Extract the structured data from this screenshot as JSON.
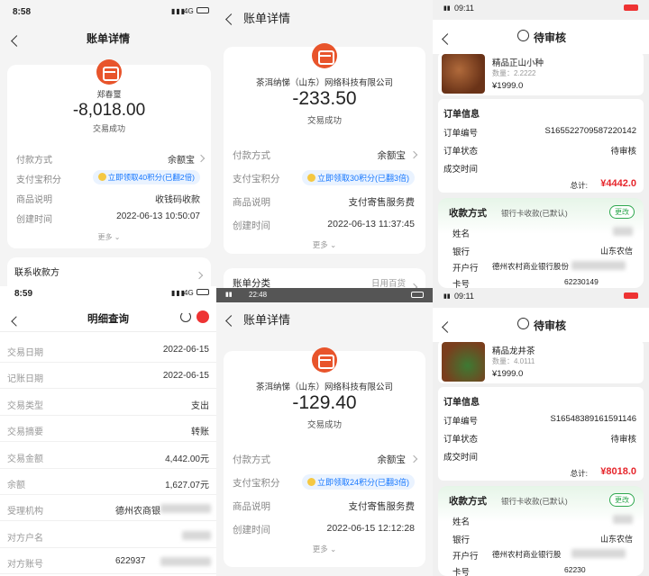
{
  "p1": {
    "status": {
      "time": "8:58",
      "net": "4G"
    },
    "title": "账单详情",
    "payee": "郑春璽",
    "amount": "-8,018.00",
    "state": "交易成功",
    "rows": [
      {
        "k": "付款方式",
        "v": "余额宝"
      },
      {
        "k": "支付宝积分",
        "v": "立即领取40积分(已翻2倍)"
      },
      {
        "k": "商品说明",
        "v": "收钱码收款"
      },
      {
        "k": "创建时间",
        "v": "2022-06-13 10:50:07"
      }
    ],
    "more": "更多",
    "contact": "联系收款方"
  },
  "p2": {
    "title": "账单详情",
    "payee": "茶洱纳悌（山东）网络科技有限公司",
    "amount": "-233.50",
    "state": "交易成功",
    "rows": [
      {
        "k": "付款方式",
        "v": "余额宝"
      },
      {
        "k": "支付宝积分",
        "v": "立即领取30积分(已翻3倍)"
      },
      {
        "k": "商品说明",
        "v": "支付寄售服务费"
      },
      {
        "k": "创建时间",
        "v": "2022-06-13 11:37:45"
      }
    ],
    "more": "更多",
    "category_k": "账单分类",
    "category_v": "日用百货"
  },
  "p3": {
    "status": {
      "time": "09:11"
    },
    "title": "待审核",
    "product": {
      "name": "精品正山小种",
      "qty": "数量：2.2222",
      "price": "¥1999.0"
    },
    "order_title": "订单信息",
    "order_rows": [
      {
        "k": "订单编号",
        "v": "S165522709587220142"
      },
      {
        "k": "订单状态",
        "v": "待审核"
      },
      {
        "k": "成交时间",
        "v": ""
      }
    ],
    "total_label": "总计:",
    "total": "¥4442.0",
    "pay_title": "收款方式",
    "pay_sub": "银行卡收款(已默认)",
    "change": "更改",
    "pay_rows": [
      {
        "k": "姓名",
        "v": ""
      },
      {
        "k": "银行",
        "v": "山东农信"
      },
      {
        "k": "开户行",
        "v": "德州农村商业银行股份"
      },
      {
        "k": "卡号",
        "v": "62230149"
      }
    ]
  },
  "p4": {
    "status": {
      "time": "8:59",
      "net": "4G"
    },
    "title": "明细查询",
    "rows": [
      {
        "k": "交易日期",
        "v": "2022-06-15"
      },
      {
        "k": "记账日期",
        "v": "2022-06-15"
      },
      {
        "k": "交易类型",
        "v": "支出"
      },
      {
        "k": "交易摘要",
        "v": "转账"
      },
      {
        "k": "交易金额",
        "v": "4,442.00元"
      },
      {
        "k": "余额",
        "v": "1,627.07元"
      },
      {
        "k": "受理机构",
        "v": "德州农商银"
      },
      {
        "k": "对方户名",
        "v": ""
      },
      {
        "k": "对方账号",
        "v": "622937"
      }
    ]
  },
  "p5": {
    "status": {
      "time": "22:48"
    },
    "title": "账单详情",
    "payee": "茶洱纳悌（山东）网络科技有限公司",
    "amount": "-129.40",
    "state": "交易成功",
    "rows": [
      {
        "k": "付款方式",
        "v": "余额宝"
      },
      {
        "k": "支付宝积分",
        "v": "立即领取24积分(已翻3倍)"
      },
      {
        "k": "商品说明",
        "v": "支付寄售服务费"
      },
      {
        "k": "创建时间",
        "v": "2022-06-15 12:12:28"
      }
    ],
    "more": "更多"
  },
  "p6": {
    "status": {
      "time": "09:11"
    },
    "title": "待审核",
    "product": {
      "name": "精品龙井茶",
      "qty": "数量：4.0111",
      "price": "¥1999.0"
    },
    "order_title": "订单信息",
    "order_rows": [
      {
        "k": "订单编号",
        "v": "S165483891615911​46"
      },
      {
        "k": "订单状态",
        "v": "待审核"
      },
      {
        "k": "成交时间",
        "v": ""
      }
    ],
    "total_label": "总计:",
    "total": "¥8018.0",
    "pay_title": "收款方式",
    "pay_sub": "银行卡收款(已默认)",
    "change": "更改",
    "pay_rows": [
      {
        "k": "姓名",
        "v": ""
      },
      {
        "k": "银行",
        "v": "山东农信"
      },
      {
        "k": "开户行",
        "v": "德州农村商业银行股"
      },
      {
        "k": "卡号",
        "v": "62230"
      }
    ]
  },
  "colors": {
    "alipay_orange": "#e8542b",
    "alipay_blue": "#1677ff",
    "total_red": "#e6262c",
    "green": "#2fa84f"
  }
}
